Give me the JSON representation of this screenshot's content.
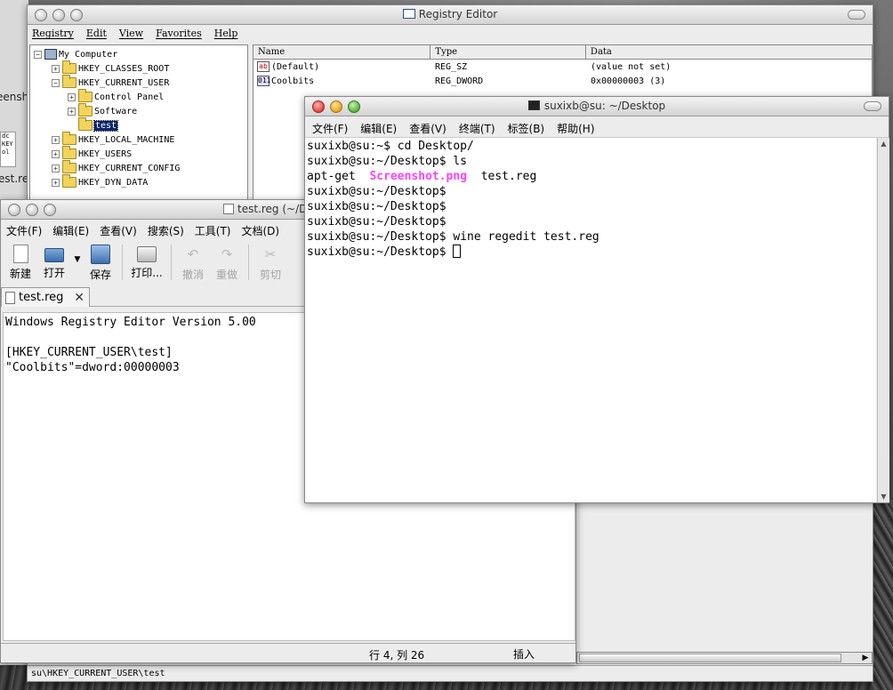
{
  "desktop": {
    "label_top": "eensh",
    "icon_text_1": "dc",
    "icon_text_2": "KEY",
    "icon_text_3": "ol",
    "label_bottom": "est.reg"
  },
  "regedit": {
    "title": "Registry Editor",
    "menu": [
      "Registry",
      "Edit",
      "View",
      "Favorites",
      "Help"
    ],
    "tree": {
      "root": "My Computer",
      "items": [
        "HKEY_CLASSES_ROOT",
        "HKEY_CURRENT_USER",
        "Control Panel",
        "Software",
        "test",
        "HKEY_LOCAL_MACHINE",
        "HKEY_USERS",
        "HKEY_CURRENT_CONFIG",
        "HKEY_DYN_DATA"
      ],
      "selected": "test"
    },
    "columns": [
      "Name",
      "Type",
      "Data"
    ],
    "values": [
      {
        "icon": "ab",
        "name": "(Default)",
        "type": "REG_SZ",
        "data": "(value not set)"
      },
      {
        "icon": "011",
        "name": "Coolbits",
        "type": "REG_DWORD",
        "data": "0x00000003 (3)"
      }
    ],
    "status": "su\\HKEY_CURRENT_USER\\test"
  },
  "gedit": {
    "title": "test.reg (~/D",
    "menu": [
      "文件(F)",
      "编辑(E)",
      "查看(V)",
      "搜索(S)",
      "工具(T)",
      "文档(D)"
    ],
    "toolbar": {
      "new": "新建",
      "open": "打开",
      "save": "保存",
      "print": "打印...",
      "undo": "撤消",
      "redo": "重做",
      "cut": "剪切"
    },
    "tab_label": "test.reg",
    "content_lines": [
      "Windows Registry Editor Version 5.00",
      "",
      "[HKEY_CURRENT_USER\\test]",
      "\"Coolbits\"=dword:00000003"
    ],
    "status_position": "行 4, 列 26",
    "status_mode": "插入"
  },
  "terminal": {
    "title": "suxixb@su: ~/Desktop",
    "menu": [
      "文件(F)",
      "编辑(E)",
      "查看(V)",
      "终端(T)",
      "标签(B)",
      "帮助(H)"
    ],
    "lines": [
      "suxixb@su:~$ cd Desktop/",
      "suxixb@su:~/Desktop$ ls",
      "",
      "suxixb@su:~/Desktop$",
      "suxixb@su:~/Desktop$",
      "suxixb@su:~/Desktop$",
      "suxixb@su:~/Desktop$ wine regedit test.reg",
      "suxixb@su:~/Desktop$ "
    ],
    "ls_output": {
      "file1": "apt-get",
      "file2": "Screenshot.png",
      "file3": "test.reg"
    },
    "colors": {
      "png_file": "#ff40ff"
    }
  }
}
